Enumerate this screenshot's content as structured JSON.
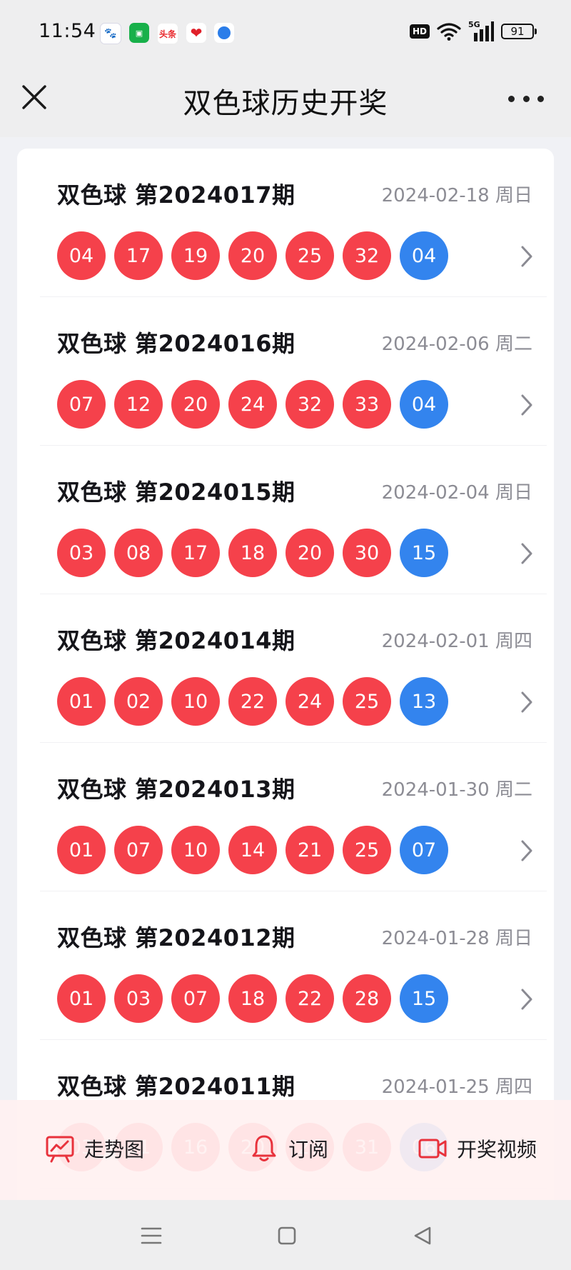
{
  "status": {
    "time": "11:54",
    "notifications": [
      "baidu-icon",
      "green-app-icon",
      "toutiao-icon",
      "heart-app-icon",
      "blue-app-icon"
    ],
    "toutiao_text": "头条",
    "hd": "HD",
    "network": "5G",
    "battery": "91"
  },
  "header": {
    "title": "双色球历史开奖"
  },
  "draws": [
    {
      "name": "双色球 第2024017期",
      "date": "2024-02-18 周日",
      "red": [
        "04",
        "17",
        "19",
        "20",
        "25",
        "32"
      ],
      "blue": "04"
    },
    {
      "name": "双色球 第2024016期",
      "date": "2024-02-06 周二",
      "red": [
        "07",
        "12",
        "20",
        "24",
        "32",
        "33"
      ],
      "blue": "04"
    },
    {
      "name": "双色球 第2024015期",
      "date": "2024-02-04 周日",
      "red": [
        "03",
        "08",
        "17",
        "18",
        "20",
        "30"
      ],
      "blue": "15"
    },
    {
      "name": "双色球 第2024014期",
      "date": "2024-02-01 周四",
      "red": [
        "01",
        "02",
        "10",
        "22",
        "24",
        "25"
      ],
      "blue": "13"
    },
    {
      "name": "双色球 第2024013期",
      "date": "2024-01-30 周二",
      "red": [
        "01",
        "07",
        "10",
        "14",
        "21",
        "25"
      ],
      "blue": "07"
    },
    {
      "name": "双色球 第2024012期",
      "date": "2024-01-28 周日",
      "red": [
        "01",
        "03",
        "07",
        "18",
        "22",
        "28"
      ],
      "blue": "15"
    },
    {
      "name": "双色球 第2024011期",
      "date": "2024-01-25 周四",
      "red": [
        "03",
        "11",
        "16",
        "20",
        "27",
        "31"
      ],
      "blue": "06"
    }
  ],
  "actions": {
    "trend_label": "走势图",
    "subscribe_label": "订阅",
    "video_label": "开奖视频"
  },
  "colors": {
    "red_ball": "#f5414b",
    "blue_ball": "#3384ee",
    "action_icon": "#e8323c"
  }
}
